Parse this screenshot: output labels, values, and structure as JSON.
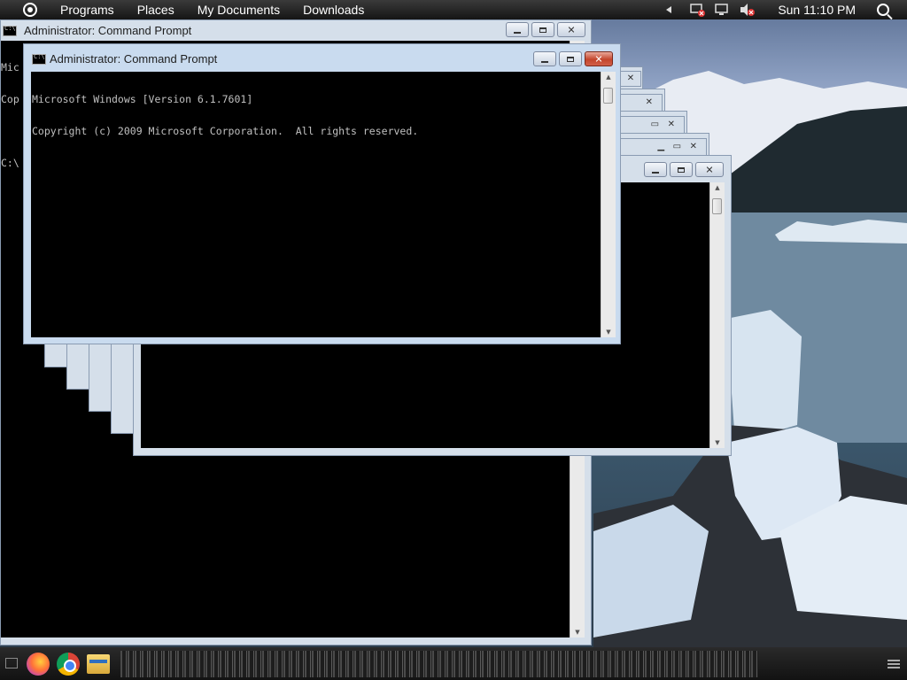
{
  "top_panel": {
    "menus": [
      "Programs",
      "Places",
      "My Documents",
      "Downloads"
    ],
    "clock": "Sun 11:10 PM",
    "tray_icons": [
      "expand-tray-icon",
      "network-disconnected-icon",
      "display-icon",
      "volume-muted-icon",
      "search-icon"
    ]
  },
  "back_window": {
    "title": "Administrator: Command Prompt",
    "visible_text": [
      "Mic",
      "Cop",
      "C:\\"
    ]
  },
  "main_window": {
    "title": "Administrator: Command Prompt",
    "console_lines": [
      "Microsoft Windows [Version 6.1.7601]",
      "Copyright (c) 2009 Microsoft Corporation.  All rights reserved."
    ]
  },
  "taskbar": {
    "apps": [
      "firefox-icon",
      "chrome-icon",
      "file-manager-icon"
    ]
  },
  "colors": {
    "titlebar": "#d5dfea",
    "console_bg": "#000000",
    "console_fg": "#c0c0c0",
    "close_button": "#c4452c"
  }
}
